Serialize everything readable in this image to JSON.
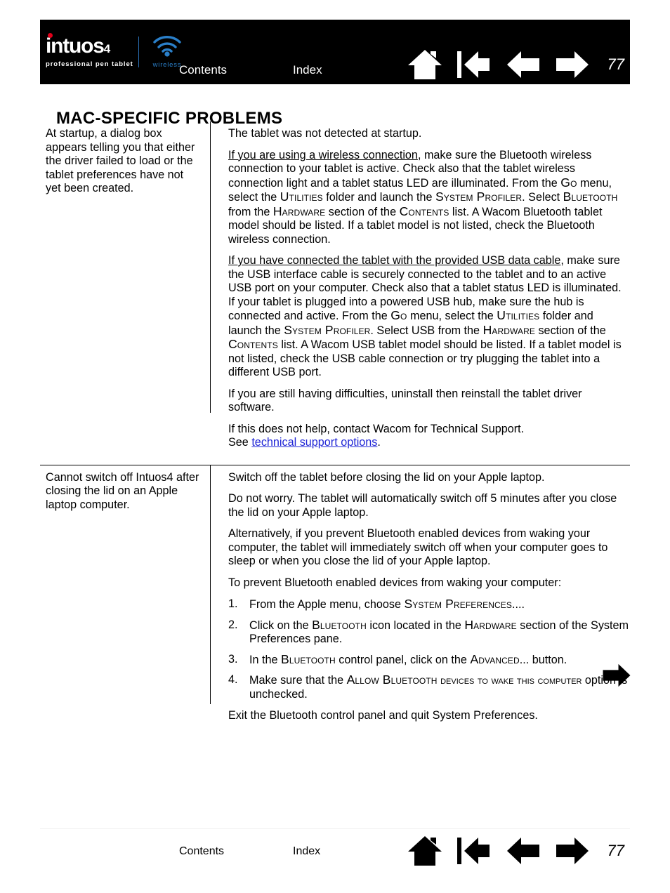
{
  "header": {
    "logo": {
      "word": "intuos",
      "number": "4",
      "tagline": "professional pen tablet",
      "wireless_label": "wireless"
    },
    "contents_label": "Contents",
    "index_label": "Index",
    "page_number": "77",
    "nav": [
      {
        "name": "home-icon",
        "label": "Home"
      },
      {
        "name": "first-page-icon",
        "label": "First page"
      },
      {
        "name": "previous-page-icon",
        "label": "Previous page"
      },
      {
        "name": "next-page-icon",
        "label": "Next page"
      }
    ],
    "colors": {
      "bar": "#000000",
      "logo_dot": "#e2001a",
      "wireless": "#2a7fc9",
      "text": "#ffffff"
    }
  },
  "page_title": "MAC-SPECIFIC PROBLEMS",
  "rows": [
    {
      "problem": "At startup, a dialog box appears telling you that either the driver failed to load or the tablet preferences have not yet been created.",
      "p1": "The tablet was not detected at startup.",
      "p2_lead": "If you are using a wireless connection",
      "p2_a": ", make sure the Bluetooth wireless connection to your tablet is active.  Check also that the tablet wireless connection light and  a tablet status LED are illuminated.  From the ",
      "p2_sc1": "Go",
      "p2_b": " menu, select the ",
      "p2_sc2": "Utilities",
      "p2_c": " folder and launch the ",
      "p2_sc3": "System Profiler",
      "p2_d": ".  Select ",
      "p2_sc4": "Bluetooth",
      "p2_e": " from the ",
      "p2_sc5": "Hardware",
      "p2_f": " section of the ",
      "p2_sc6": "Contents",
      "p2_g": " list.  A Wacom Bluetooth tablet model should be listed.  If a tablet model is not listed, check the Bluetooth wireless connection.",
      "p3_lead": "If you have connected the tablet with the provided USB data cable",
      "p3_a": ", make sure the USB interface cable is securely connected to the tablet and to an active USB port on your computer.  Check also that a tablet status LED is illuminated.  If your tablet is plugged into a powered USB hub, make sure the hub is connected and active.  From the ",
      "p3_sc1": "Go",
      "p3_b": " menu, select the ",
      "p3_sc2": "Utilities",
      "p3_c": " folder and launch the ",
      "p3_sc3": "System Profiler",
      "p3_d": ".  Select USB from the ",
      "p3_sc4": "Hardware",
      "p3_e": " section of the ",
      "p3_sc5": "Contents",
      "p3_f": " list.  A Wacom USB tablet model should be listed.  If a tablet model is not listed, check the USB cable connection or try plugging the tablet into a different USB port.",
      "p4": "If you are still having difficulties, uninstall then reinstall the tablet driver software.",
      "p5_a": "If this does not help, contact Wacom for Technical Support.",
      "p5_b": "See ",
      "p5_link": "technical support options",
      "p5_c": "."
    },
    {
      "problem": "Cannot switch off Intuos4 after closing the lid on an Apple laptop computer.",
      "p1": "Switch off the tablet before closing the lid on your Apple laptop.",
      "p2": "Do not worry.  The tablet will automatically switch off 5 minutes after you close the lid on your Apple laptop.",
      "p3": "Alternatively, if you prevent Bluetooth enabled devices from waking your computer, the tablet will immediately switch off when your computer goes to sleep or when you close the lid of your Apple laptop.",
      "p4": "To prevent Bluetooth enabled devices from waking your computer:",
      "steps": [
        {
          "a": "From the Apple menu, choose ",
          "sc1": "System Preferences",
          "b": "...."
        },
        {
          "a": "Click on the ",
          "sc1": "Bluetooth",
          "b": " icon located in the ",
          "sc2": "Hardware",
          "c": " section of the System Preferences pane."
        },
        {
          "a": "In the ",
          "sc1": "Bluetooth",
          "b": " control panel, click on the ",
          "sc2": "Advanced",
          "c": "... button."
        },
        {
          "a": "Make sure that the ",
          "sc1": "Allow Bluetooth",
          "b": " ",
          "sc_small": "devices to wake this computer",
          "c": " option is unchecked."
        }
      ],
      "p5": "Exit the Bluetooth control panel and quit System Preferences."
    }
  ],
  "inline_arrow": {
    "name": "next-page-icon",
    "label": "Next page"
  },
  "footer": {
    "contents_label": "Contents",
    "index_label": "Index",
    "page_number": "77",
    "nav": [
      {
        "name": "home-icon",
        "label": "Home"
      },
      {
        "name": "first-page-icon",
        "label": "First page"
      },
      {
        "name": "previous-page-icon",
        "label": "Previous page"
      },
      {
        "name": "next-page-icon",
        "label": "Next page"
      }
    ]
  }
}
